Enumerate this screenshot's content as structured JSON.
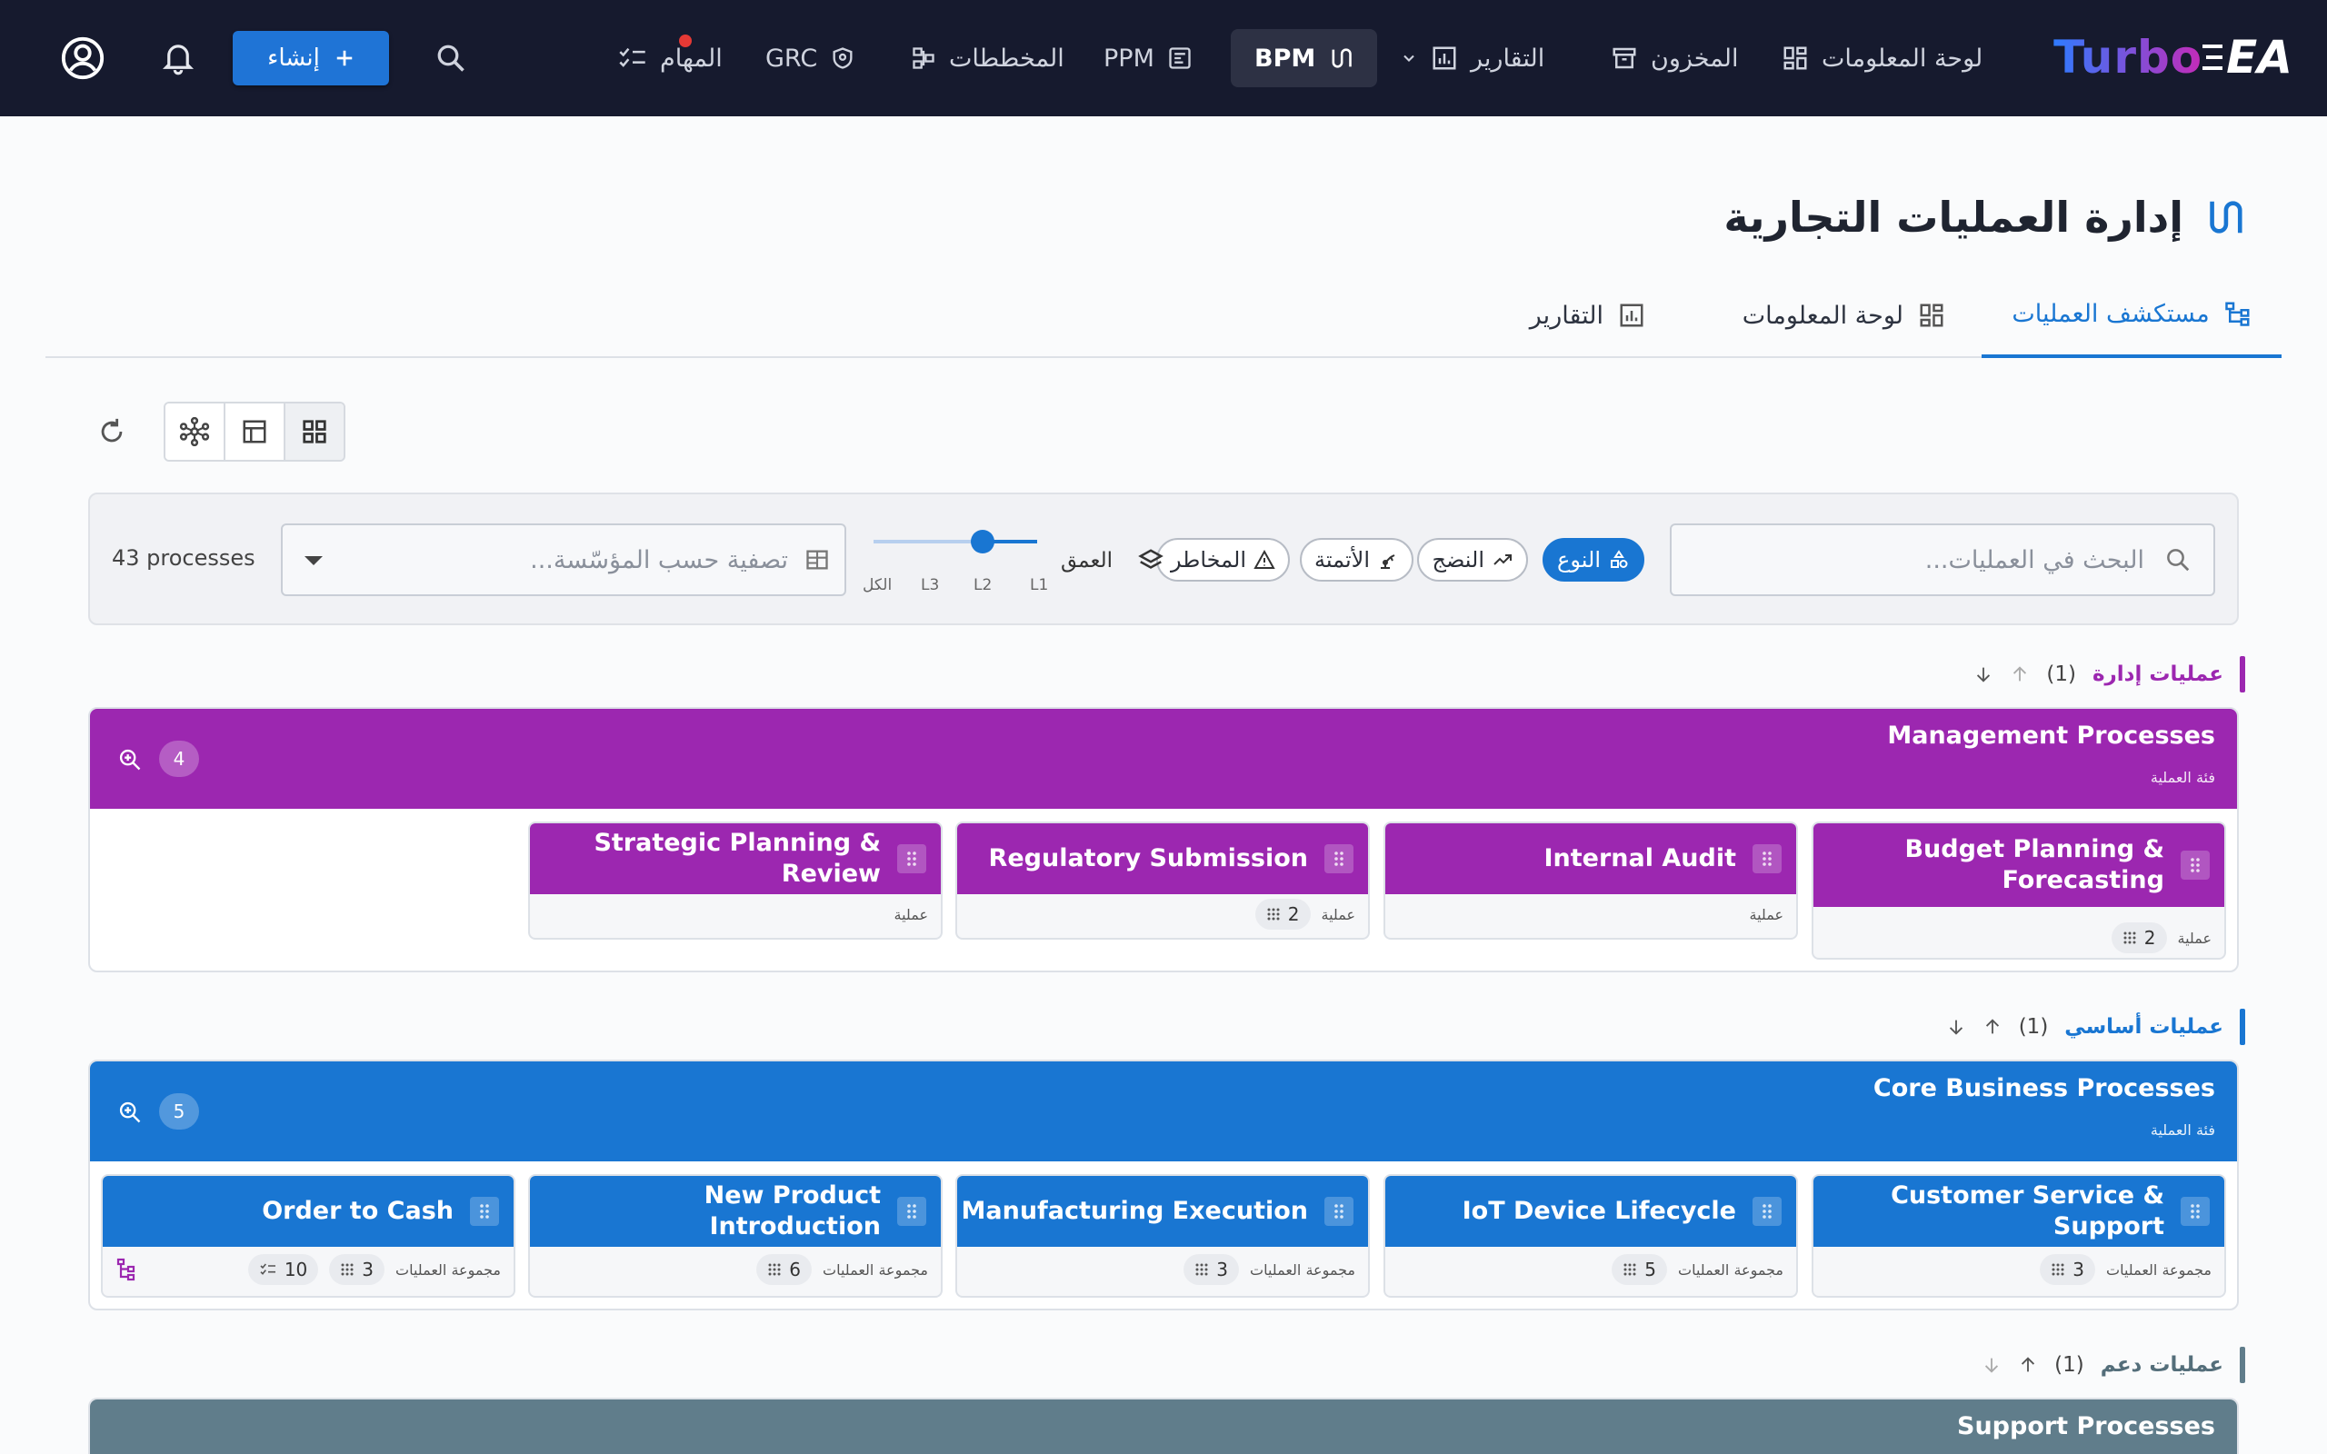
{
  "header": {
    "logo_turbo": "Turbo",
    "logo_ea": "EA",
    "nav": {
      "dashboard": "لوحة المعلومات",
      "inventory": "المخزون",
      "reports": "التقارير",
      "bpm": "BPM",
      "ppm": "PPM",
      "diagrams": "المخططات",
      "grc": "GRC",
      "tasks": "المهام"
    },
    "create_label": "إنشاء"
  },
  "page": {
    "title": "إدارة العمليات التجارية",
    "tabs": {
      "explorer": "مستكشف العمليات",
      "dashboard": "لوحة المعلومات",
      "reports": "التقارير"
    }
  },
  "filters": {
    "search_placeholder": "البحث في العمليات...",
    "chips": {
      "type": "النوع",
      "maturity": "النضج",
      "automation": "الأتمتة",
      "risk": "المخاطر"
    },
    "depth_label": "العمق",
    "depth_ticks": {
      "l1": "L1",
      "l2": "L2",
      "l3": "L3",
      "all": "الكل"
    },
    "depth_value": "L2",
    "org_placeholder": "تصفية حسب المؤسّسة...",
    "count_text": "43 processes"
  },
  "colors": {
    "management": "#9c27b0",
    "core": "#1976d2",
    "support": "#607d8b"
  },
  "sections": {
    "management": {
      "label": "عمليات إدارة",
      "count": "(1)",
      "group_title": "Management Processes",
      "group_subtitle": "فئة العملية",
      "badge": "4",
      "cards": [
        {
          "title": "Budget Planning & Forecasting",
          "type": "عملية",
          "count": "2"
        },
        {
          "title": "Internal Audit",
          "type": "عملية",
          "count": ""
        },
        {
          "title": "Regulatory Submission",
          "type": "عملية",
          "count": "2"
        },
        {
          "title": "Strategic Planning & Review",
          "type": "عملية",
          "count": ""
        }
      ]
    },
    "core": {
      "label": "عمليات أساسي",
      "count": "(1)",
      "group_title": "Core Business Processes",
      "group_subtitle": "فئة العملية",
      "badge": "5",
      "cards": [
        {
          "title": "Customer Service & Support",
          "type": "مجموعة العمليات",
          "count": "3"
        },
        {
          "title": "IoT Device Lifecycle",
          "type": "مجموعة العمليات",
          "count": "5"
        },
        {
          "title": "Manufacturing Execution",
          "type": "مجموعة العمليات",
          "count": "3"
        },
        {
          "title": "New Product Introduction",
          "type": "مجموعة العمليات",
          "count": "6"
        },
        {
          "title": "Order to Cash",
          "type": "مجموعة العمليات",
          "count": "3",
          "tasks": "10"
        }
      ]
    },
    "support": {
      "label": "عمليات دعم",
      "count": "(1)",
      "group_title": "Support Processes"
    }
  }
}
